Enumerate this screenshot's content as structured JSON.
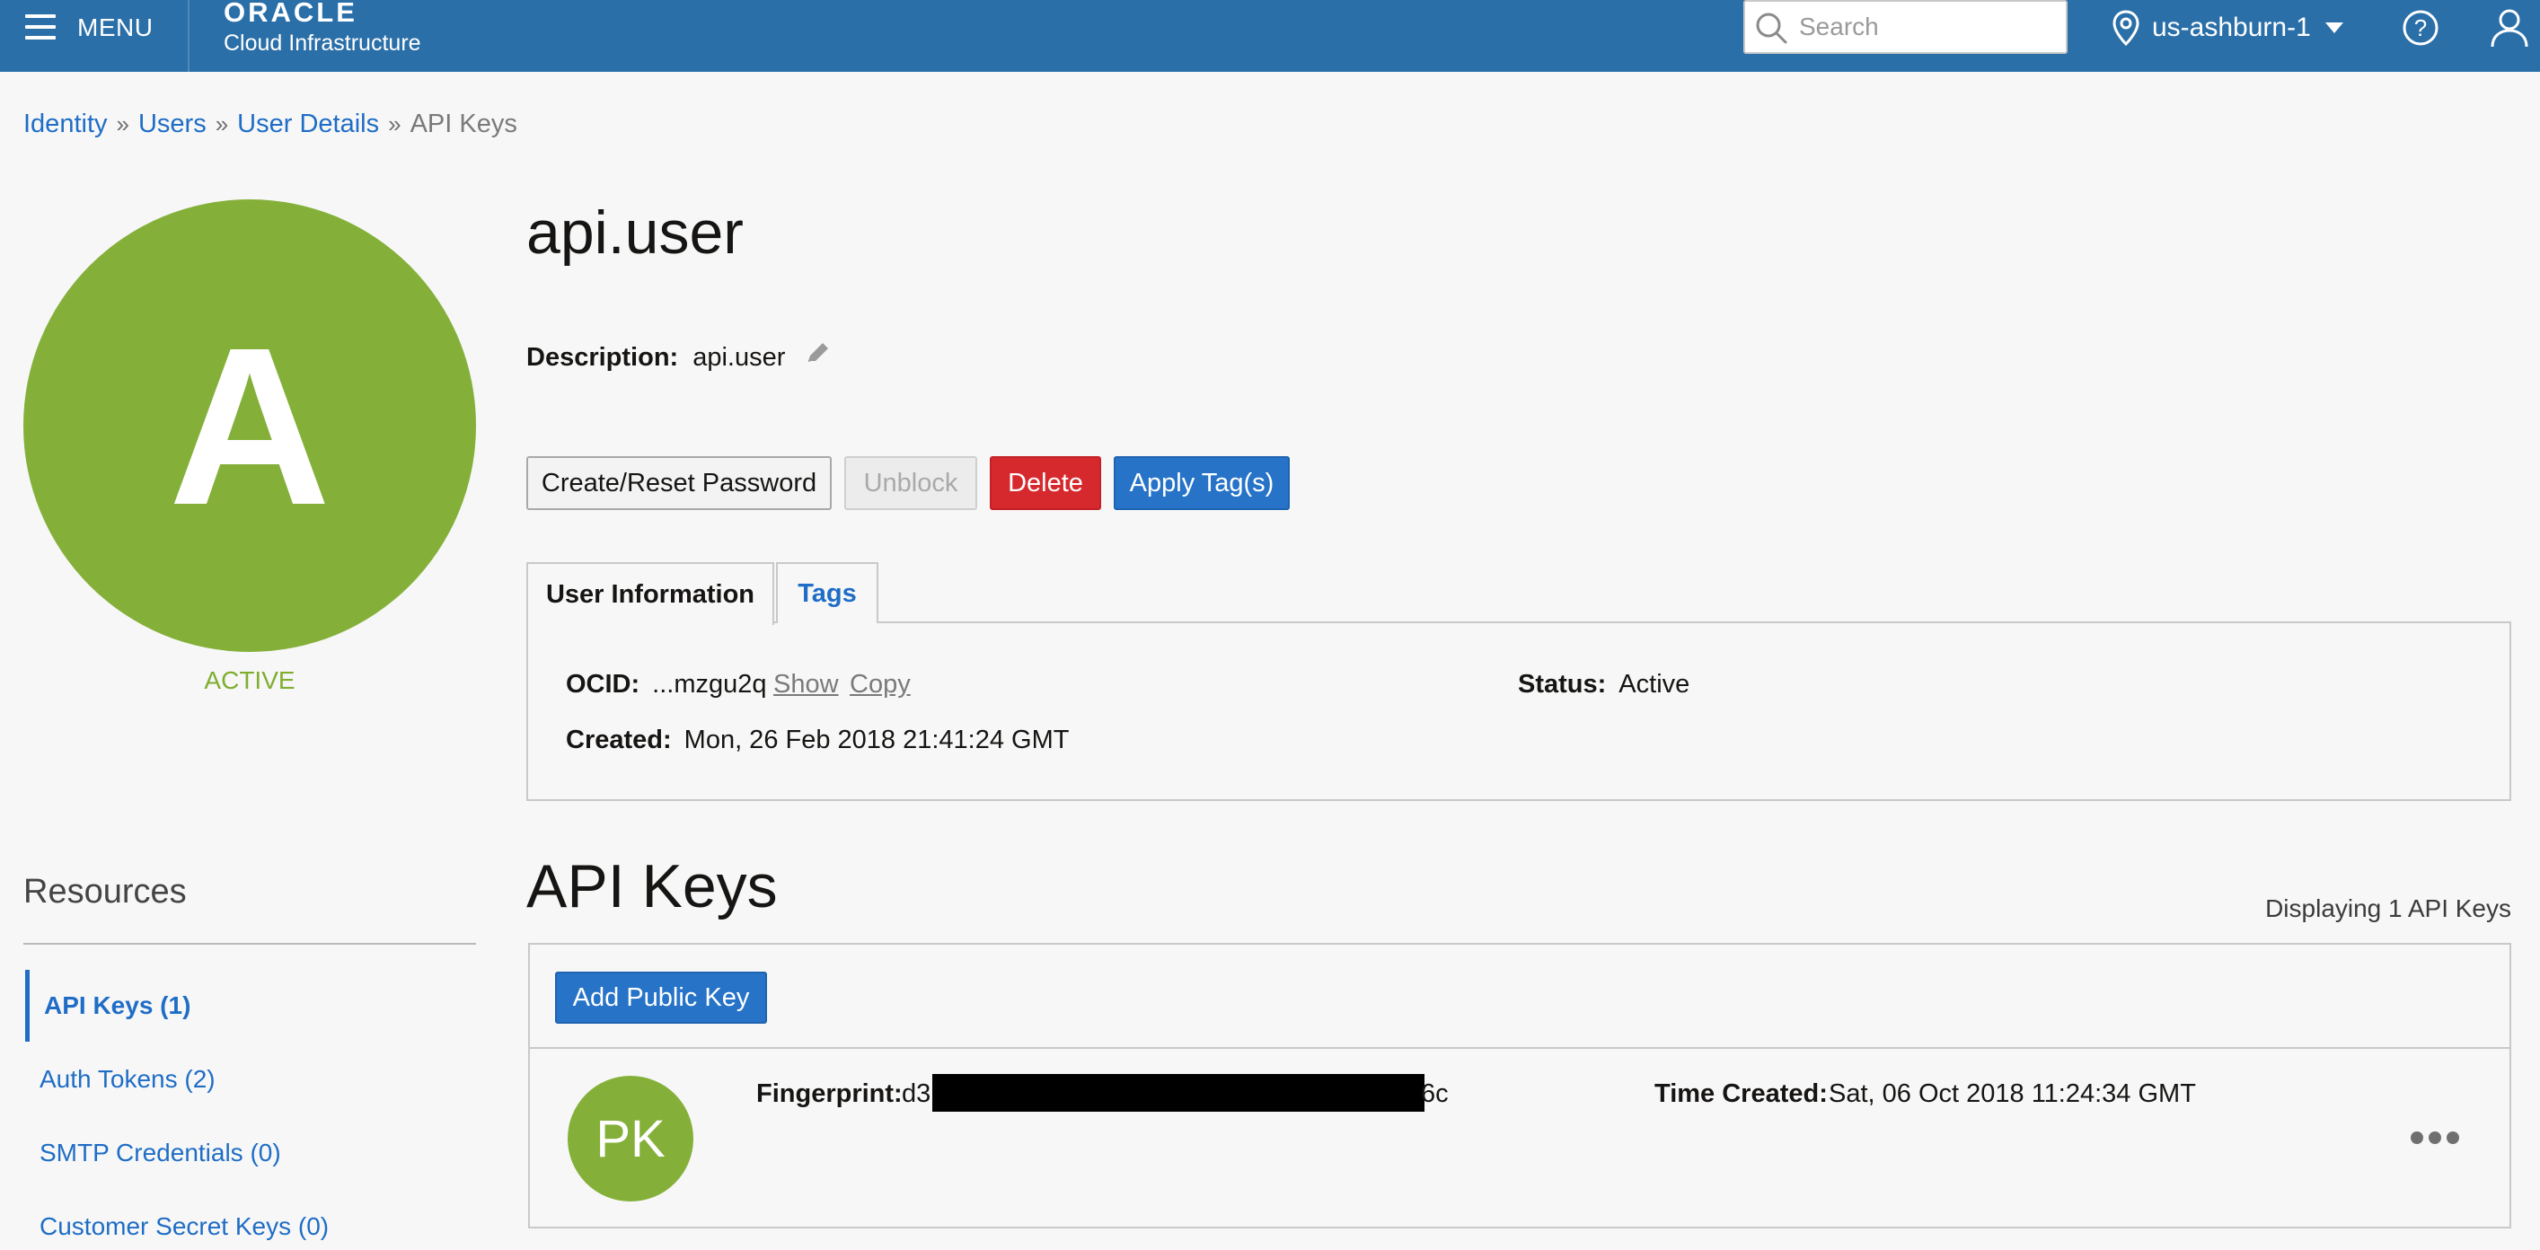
{
  "topbar": {
    "menu_label": "MENU",
    "brand_name": "ORACLE",
    "brand_subtitle": "Cloud Infrastructure",
    "search_placeholder": "Search",
    "region": "us-ashburn-1"
  },
  "breadcrumb": {
    "items": [
      "Identity",
      "Users",
      "User Details"
    ],
    "current": "API Keys",
    "separator": "»"
  },
  "user": {
    "avatar_letter": "A",
    "status": "ACTIVE",
    "name": "api.user",
    "description_label": "Description:",
    "description": "api.user"
  },
  "actions": {
    "reset_password": "Create/Reset Password",
    "unblock": "Unblock",
    "delete": "Delete",
    "apply_tags": "Apply Tag(s)"
  },
  "tabs": {
    "user_information": "User Information",
    "tags": "Tags"
  },
  "info": {
    "ocid_label": "OCID:",
    "ocid_value": "...mzgu2q",
    "ocid_show": "Show",
    "ocid_copy": "Copy",
    "status_label": "Status:",
    "status_value": "Active",
    "created_label": "Created:",
    "created_value": "Mon, 26 Feb 2018 21:41:24 GMT"
  },
  "resources": {
    "title": "Resources",
    "items": [
      {
        "label": "API Keys (1)"
      },
      {
        "label": "Auth Tokens (2)"
      },
      {
        "label": "SMTP Credentials (0)"
      },
      {
        "label": "Customer Secret Keys (0)"
      }
    ]
  },
  "api_keys": {
    "title": "API Keys",
    "count_text": "Displaying 1 API Keys",
    "add_button": "Add Public Key",
    "rows": [
      {
        "avatar": "PK",
        "fingerprint_label": "Fingerprint:",
        "fingerprint_start": "d3",
        "fingerprint_end": "6c",
        "time_created_label": "Time Created:",
        "time_created": "Sat, 06 Oct 2018 11:24:34 GMT"
      }
    ]
  },
  "colors": {
    "topbar": "#2a6fa8",
    "link": "#1f6dc6",
    "avatar_green": "#84b03a",
    "delete_red": "#d6292e",
    "primary_blue": "#2673c8"
  },
  "icons": [
    "hamburger-icon",
    "search-icon",
    "location-pin-icon",
    "caret-down-icon",
    "help-icon",
    "user-profile-icon",
    "pencil-icon",
    "more-actions-icon"
  ]
}
